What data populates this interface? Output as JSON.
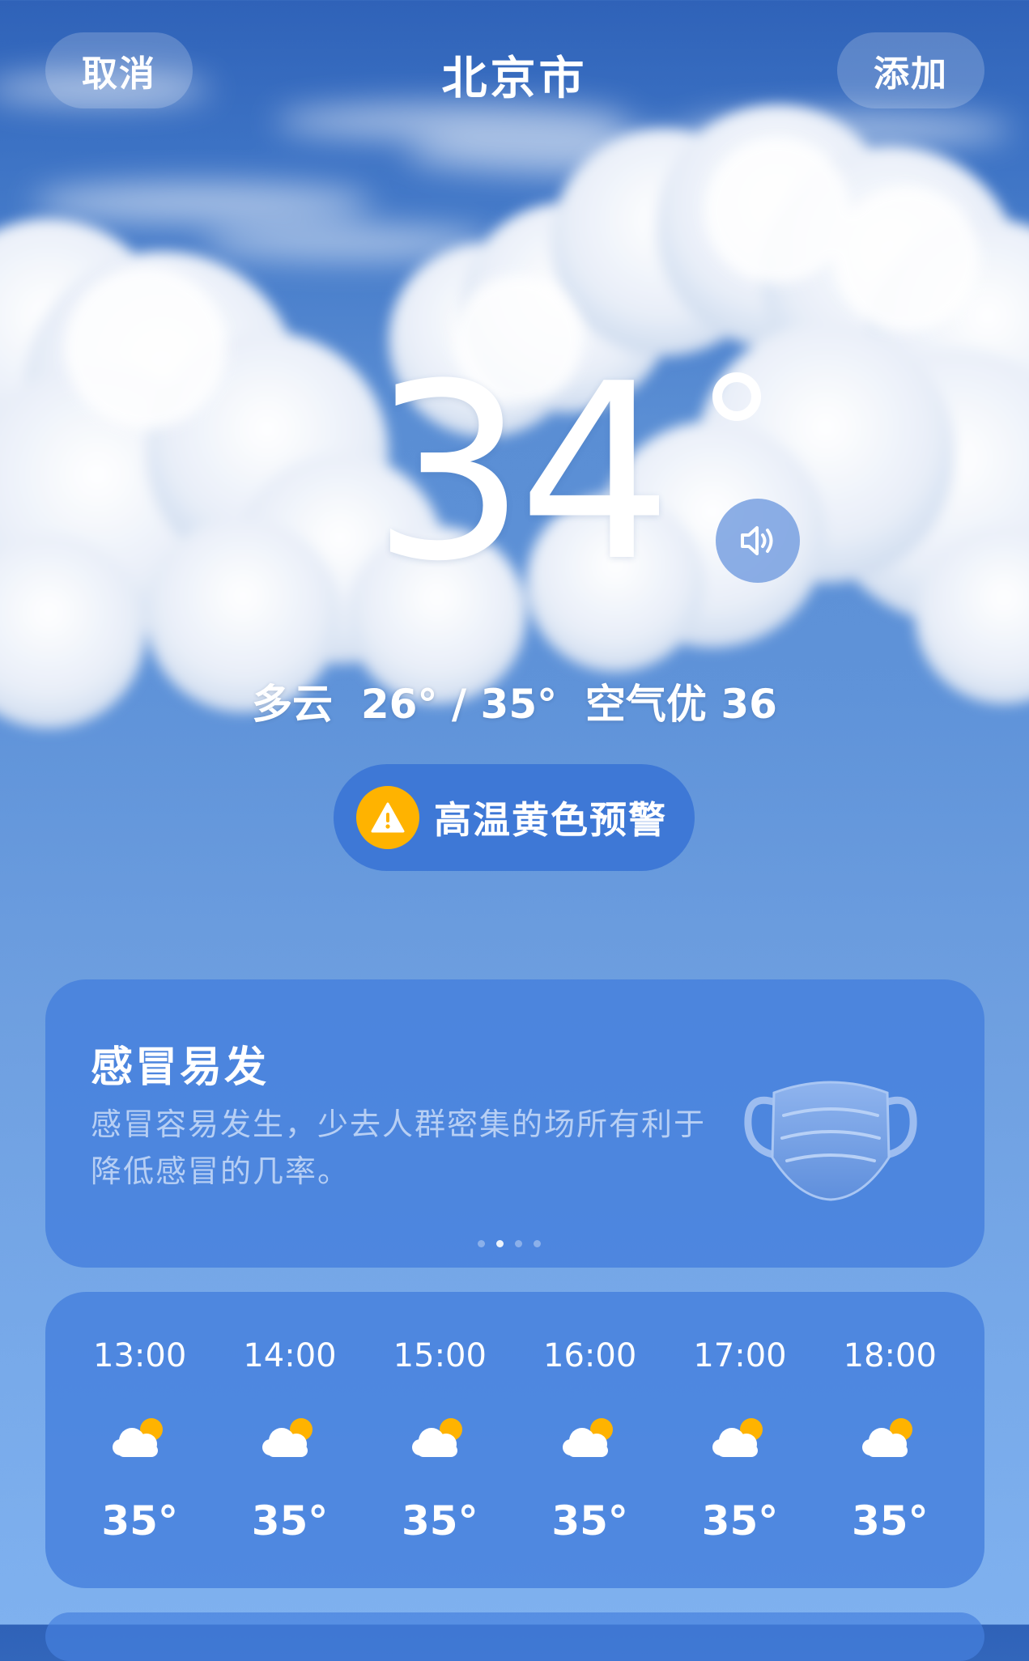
{
  "header": {
    "cancel_label": "取消",
    "city": "北京市",
    "add_label": "添加"
  },
  "current": {
    "temperature": "34",
    "condition": "多云",
    "low": "26°",
    "high": "35°",
    "air_quality_label": "空气优",
    "air_quality_value": "36",
    "summary": "多云  26° / 35°  空气优 36"
  },
  "alert": {
    "label": "高温黄色预警",
    "color": "#ffb300"
  },
  "tip": {
    "title": "感冒易发",
    "description": "感冒容易发生，少去人群密集的场所有利于降低感冒的几率。",
    "page_count": 4,
    "active_page": 2
  },
  "hourly": [
    {
      "time": "13:00",
      "icon": "partly-cloudy-icon",
      "temp": "35°"
    },
    {
      "time": "14:00",
      "icon": "partly-cloudy-icon",
      "temp": "35°"
    },
    {
      "time": "15:00",
      "icon": "partly-cloudy-icon",
      "temp": "35°"
    },
    {
      "time": "16:00",
      "icon": "partly-cloudy-icon",
      "temp": "35°"
    },
    {
      "time": "17:00",
      "icon": "partly-cloudy-icon",
      "temp": "35°"
    },
    {
      "time": "18:00",
      "icon": "partly-cloudy-icon",
      "temp": "35°"
    }
  ],
  "colors": {
    "card_bg": "#4a82dc",
    "sky_top": "#2f62b8",
    "sun": "#ffb300"
  }
}
